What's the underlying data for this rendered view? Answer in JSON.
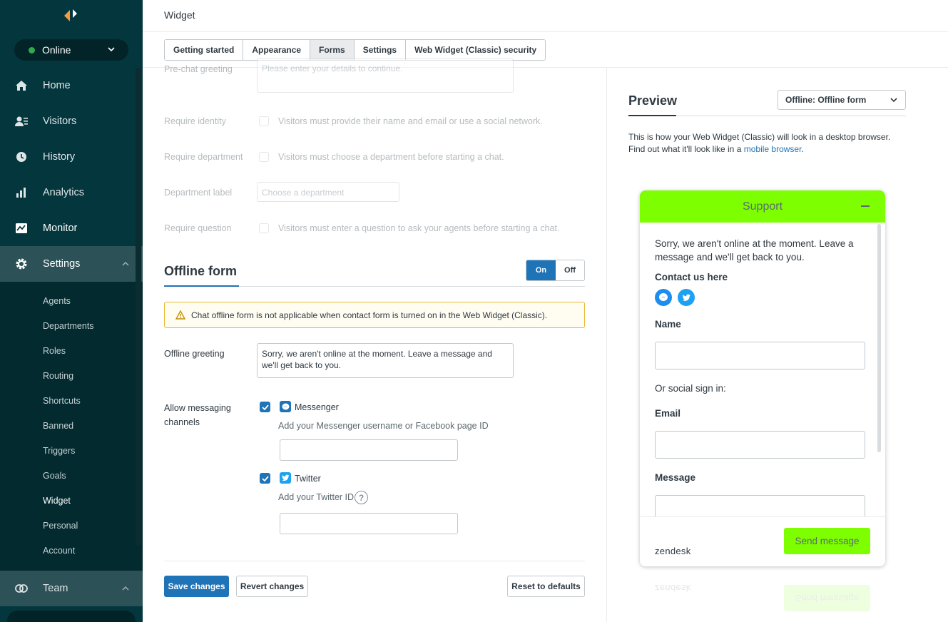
{
  "sidebar": {
    "status": "Online",
    "nav": [
      {
        "label": "Home",
        "icon": "home-icon"
      },
      {
        "label": "Visitors",
        "icon": "visitors-icon"
      },
      {
        "label": "History",
        "icon": "clock-icon"
      },
      {
        "label": "Analytics",
        "icon": "bar-chart-icon"
      },
      {
        "label": "Monitor",
        "icon": "monitor-icon"
      },
      {
        "label": "Settings",
        "icon": "gear-icon"
      }
    ],
    "settings_items": [
      "Agents",
      "Departments",
      "Roles",
      "Routing",
      "Shortcuts",
      "Banned",
      "Triggers",
      "Goals",
      "Widget",
      "Personal",
      "Account"
    ],
    "active_settings_item": "Widget",
    "team": "Team"
  },
  "header": {
    "title": "Widget"
  },
  "tabs": [
    "Getting started",
    "Appearance",
    "Forms",
    "Settings",
    "Web Widget (Classic) security"
  ],
  "active_tab": "Forms",
  "prechat": {
    "greeting_label": "Pre-chat greeting",
    "greeting_placeholder": "Please enter your details to continue.",
    "require_identity_label": "Require identity",
    "require_identity_desc": "Visitors must provide their name and email or use a social network.",
    "require_department_label": "Require department",
    "require_department_desc": "Visitors must choose a department before starting a chat.",
    "department_label_label": "Department label",
    "department_label_placeholder": "Choose a department",
    "require_question_label": "Require question",
    "require_question_desc": "Visitors must enter a question to ask your agents before starting a chat."
  },
  "offline": {
    "title": "Offline form",
    "toggle_on": "On",
    "toggle_off": "Off",
    "warning": "Chat offline form is not applicable when contact form is turned on in the Web Widget (Classic).",
    "greeting_label": "Offline greeting",
    "greeting_value": "Sorry, we aren't online at the moment. Leave a message and we'll get back to you.",
    "channels_label": "Allow messaging channels",
    "messenger_label": "Messenger",
    "messenger_hint": "Add your Messenger username or Facebook page ID",
    "twitter_label": "Twitter",
    "twitter_hint": "Add your Twitter ID",
    "help_glyph": "?"
  },
  "buttons": {
    "save": "Save changes",
    "revert": "Revert changes",
    "reset": "Reset to defaults"
  },
  "preview": {
    "title": "Preview",
    "select_value": "Offline: Offline form",
    "desc_line1": "This is how your Web Widget (Classic) will look in a desktop browser.",
    "desc_line2": "Find out what it'll look like in a",
    "desc_link": "mobile browser",
    "desc_end": "."
  },
  "widget": {
    "header": "Support",
    "message": "Sorry, we aren't online at the moment. Leave a message and we'll get back to you.",
    "contact": "Contact us here",
    "name": "Name",
    "social": "Or social sign in:",
    "email": "Email",
    "message_label": "Message",
    "brand": "zendesk",
    "send": "Send message",
    "accent": "#7dff00"
  },
  "colors": {
    "sidebar": "#03363d",
    "primary": "#1f73b7",
    "warning": "#e8b630"
  }
}
